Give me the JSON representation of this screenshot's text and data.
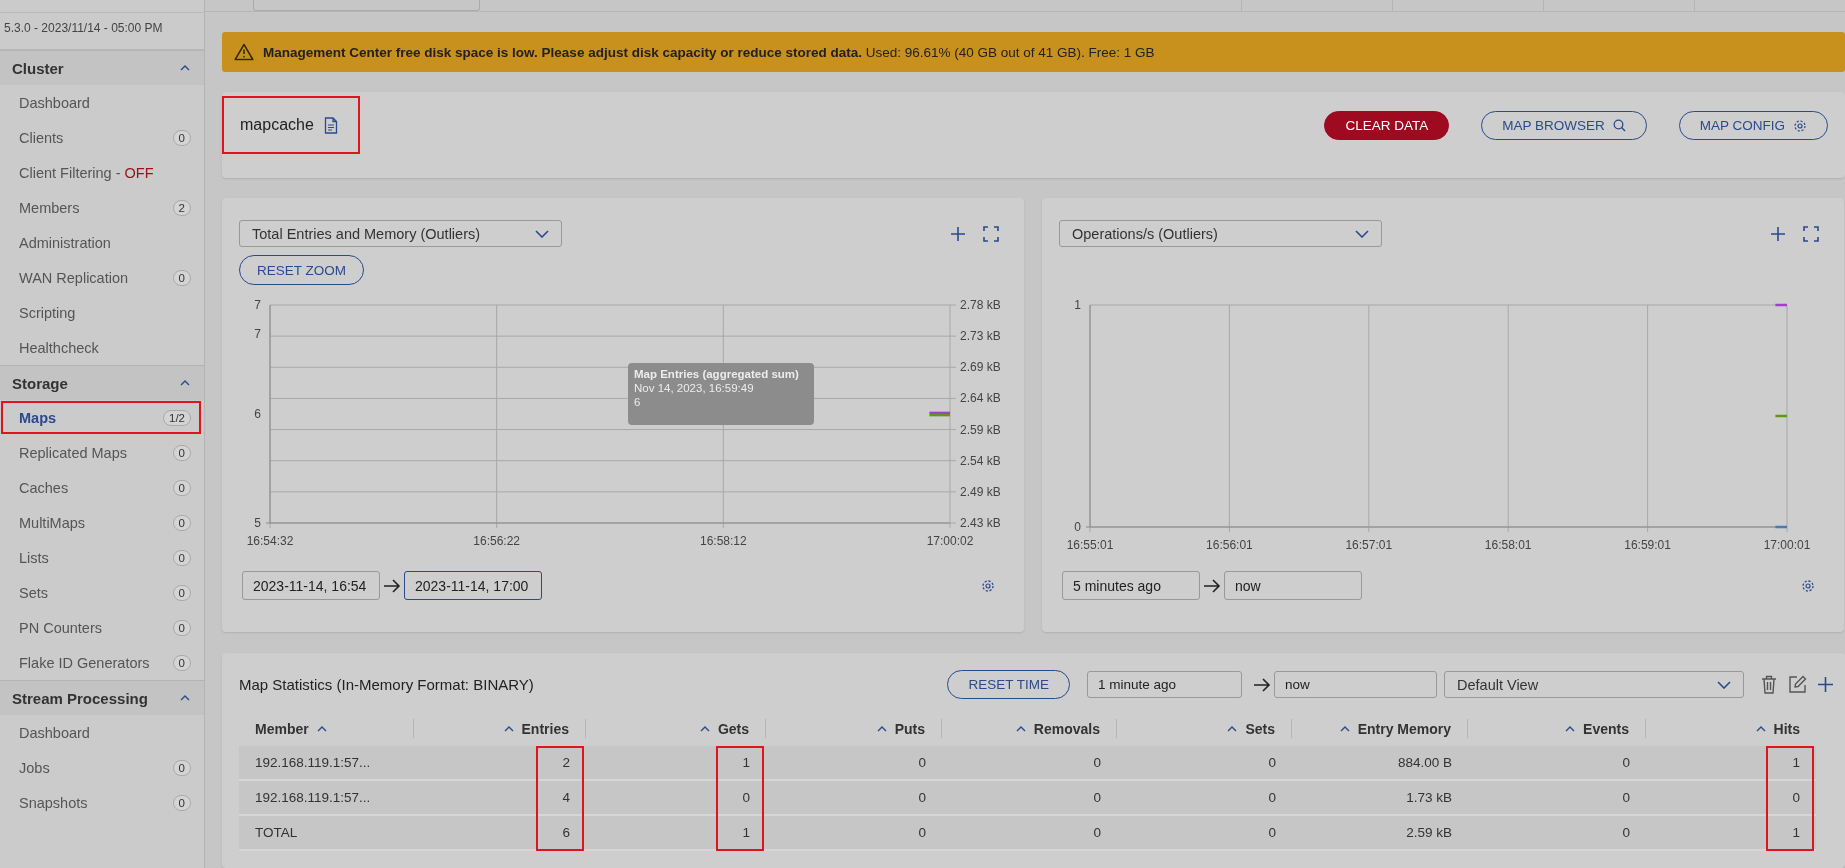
{
  "sidebar": {
    "version": "5.3.0 - 2023/11/14 - 05:00 PM",
    "sections": [
      {
        "title": "Cluster",
        "expanded": true,
        "items": [
          {
            "label": "Dashboard",
            "selected": false,
            "highlighted": false
          },
          {
            "label": "Clients",
            "badge": "0",
            "selected": false,
            "highlighted": false
          },
          {
            "label": "Client Filtering -",
            "status": "OFF",
            "selected": false,
            "highlighted": false
          },
          {
            "label": "Members",
            "badge": "2",
            "selected": false,
            "highlighted": false
          },
          {
            "label": "Administration",
            "selected": false,
            "highlighted": false
          },
          {
            "label": "WAN Replication",
            "badge": "0",
            "selected": false,
            "highlighted": false
          },
          {
            "label": "Scripting",
            "selected": false,
            "highlighted": false
          },
          {
            "label": "Healthcheck",
            "selected": false,
            "highlighted": false
          }
        ]
      },
      {
        "title": "Storage",
        "expanded": true,
        "items": [
          {
            "label": "Maps",
            "badge": "1/2",
            "selected": true,
            "highlighted": true
          },
          {
            "label": "Replicated Maps",
            "badge": "0",
            "selected": false,
            "highlighted": false
          },
          {
            "label": "Caches",
            "badge": "0",
            "selected": false,
            "highlighted": false
          },
          {
            "label": "MultiMaps",
            "badge": "0",
            "selected": false,
            "highlighted": false
          },
          {
            "label": "Lists",
            "badge": "0",
            "selected": false,
            "highlighted": false
          },
          {
            "label": "Sets",
            "badge": "0",
            "selected": false,
            "highlighted": false
          },
          {
            "label": "PN Counters",
            "badge": "0",
            "selected": false,
            "highlighted": false
          },
          {
            "label": "Flake ID Generators",
            "badge": "0",
            "selected": false,
            "highlighted": false
          }
        ]
      },
      {
        "title": "Stream Processing",
        "expanded": true,
        "items": [
          {
            "label": "Dashboard",
            "selected": false,
            "highlighted": false
          },
          {
            "label": "Jobs",
            "badge": "0",
            "selected": false,
            "highlighted": false
          },
          {
            "label": "Snapshots",
            "badge": "0",
            "selected": false,
            "highlighted": false
          }
        ]
      }
    ]
  },
  "banner": {
    "message": "**Management Center free disk space is low. Please adjust disk capacity or reduce stored data.** Used: 96.61% (40 GB out of 41 GB). Free: 1 GB"
  },
  "header": {
    "title": "mapcache",
    "highlighted": true,
    "buttons": [
      {
        "label": "CLEAR DATA",
        "kind": "danger"
      },
      {
        "label": "MAP BROWSER",
        "kind": "search"
      },
      {
        "label": "MAP CONFIG",
        "kind": "config"
      }
    ]
  },
  "charts": [
    {
      "metric": "Total Entries and Memory (Outliers)",
      "reset_zoom": "RESET ZOOM",
      "range_from": "2023-11-14, 16:54",
      "range_to": "2023-11-14, 17:00",
      "range_to_focused": true,
      "tooltip": {
        "title": "Map Entries (aggregated sum)",
        "time": "Nov 14, 2023, 16:59:49",
        "value": "6"
      },
      "chart_data": {
        "type": "line",
        "grid": true,
        "ylim": [
          5,
          7
        ],
        "categories": [
          "16:54:32",
          null,
          null,
          null,
          null,
          null,
          null,
          null,
          null,
          null,
          null,
          "16:56:22",
          null,
          null,
          null,
          null,
          null,
          null,
          null,
          null,
          null,
          null,
          "16:58:12",
          null,
          null,
          null,
          null,
          null,
          null,
          null,
          null,
          null,
          null,
          "17:00:02"
        ],
        "yticks": [
          {
            "value": 7,
            "label": "7"
          },
          {
            "value": 6.73,
            "label": "7"
          },
          {
            "value": 6,
            "label": "6"
          },
          {
            "value": 5,
            "label": "5"
          }
        ],
        "y2ticks": [
          "2.78 kB",
          "2.73 kB",
          "2.69 kB",
          "2.64 kB",
          "2.59 kB",
          "2.54 kB",
          "2.49 kB",
          "2.43 kB"
        ],
        "series": [
          {
            "color": "#a040c8",
            "values": [
              null,
              null,
              null,
              null,
              null,
              null,
              null,
              null,
              null,
              null,
              null,
              null,
              null,
              null,
              null,
              null,
              null,
              null,
              null,
              null,
              null,
              null,
              null,
              null,
              null,
              null,
              null,
              null,
              null,
              null,
              null,
              null,
              6.01,
              6.01
            ]
          },
          {
            "color": "#5a9a10",
            "values": [
              null,
              null,
              null,
              null,
              null,
              null,
              null,
              null,
              null,
              null,
              null,
              null,
              null,
              null,
              null,
              null,
              null,
              null,
              null,
              null,
              null,
              null,
              null,
              null,
              null,
              null,
              null,
              null,
              null,
              null,
              null,
              null,
              5.99,
              5.99
            ]
          }
        ]
      }
    },
    {
      "metric": "Operations/s (Outliers)",
      "range_from": "5 minutes ago",
      "range_to": "now",
      "range_to_focused": false,
      "chart_data": {
        "type": "line",
        "grid": true,
        "ylim": [
          0,
          1
        ],
        "categories": [
          "16:55:01",
          null,
          null,
          null,
          null,
          null,
          null,
          null,
          null,
          null,
          null,
          null,
          "16:56:01",
          null,
          null,
          null,
          null,
          null,
          null,
          null,
          null,
          null,
          null,
          null,
          "16:57:01",
          null,
          null,
          null,
          null,
          null,
          null,
          null,
          null,
          null,
          null,
          null,
          "16:58:01",
          null,
          null,
          null,
          null,
          null,
          null,
          null,
          null,
          null,
          null,
          null,
          "16:59:01",
          null,
          null,
          null,
          null,
          null,
          null,
          null,
          null,
          null,
          null,
          null,
          "17:00:01"
        ],
        "yticks": [
          0,
          1
        ],
        "series": [
          {
            "color": "#a040c8",
            "values": [
              null,
              null,
              null,
              null,
              null,
              null,
              null,
              null,
              null,
              null,
              null,
              null,
              null,
              null,
              null,
              null,
              null,
              null,
              null,
              null,
              null,
              null,
              null,
              null,
              null,
              null,
              null,
              null,
              null,
              null,
              null,
              null,
              null,
              null,
              null,
              null,
              null,
              null,
              null,
              null,
              null,
              null,
              null,
              null,
              null,
              null,
              null,
              null,
              null,
              null,
              null,
              null,
              null,
              null,
              null,
              null,
              null,
              null,
              null,
              1,
              1
            ]
          },
          {
            "color": "#5a9a10",
            "values": [
              null,
              null,
              null,
              null,
              null,
              null,
              null,
              null,
              null,
              null,
              null,
              null,
              null,
              null,
              null,
              null,
              null,
              null,
              null,
              null,
              null,
              null,
              null,
              null,
              null,
              null,
              null,
              null,
              null,
              null,
              null,
              null,
              null,
              null,
              null,
              null,
              null,
              null,
              null,
              null,
              null,
              null,
              null,
              null,
              null,
              null,
              null,
              null,
              null,
              null,
              null,
              null,
              null,
              null,
              null,
              null,
              null,
              null,
              null,
              0.5,
              0.5
            ]
          },
          {
            "color": "#4a7ab0",
            "values": [
              null,
              null,
              null,
              null,
              null,
              null,
              null,
              null,
              null,
              null,
              null,
              null,
              null,
              null,
              null,
              null,
              null,
              null,
              null,
              null,
              null,
              null,
              null,
              null,
              null,
              null,
              null,
              null,
              null,
              null,
              null,
              null,
              null,
              null,
              null,
              null,
              null,
              null,
              null,
              null,
              null,
              null,
              null,
              null,
              null,
              null,
              null,
              null,
              null,
              null,
              null,
              null,
              null,
              null,
              null,
              null,
              null,
              null,
              null,
              0,
              0
            ]
          }
        ]
      }
    }
  ],
  "stats": {
    "title": "Map Statistics (In-Memory Format: BINARY)",
    "reset_time": "RESET TIME",
    "range_from": "1 minute ago",
    "range_to": "now",
    "view": "Default View",
    "columns": [
      {
        "label": "Member",
        "highlighted": false
      },
      {
        "label": "Entries",
        "highlighted": true
      },
      {
        "label": "Gets",
        "highlighted": true
      },
      {
        "label": "Puts",
        "highlighted": false
      },
      {
        "label": "Removals",
        "highlighted": false
      },
      {
        "label": "Sets",
        "highlighted": false
      },
      {
        "label": "Entry Memory",
        "highlighted": false
      },
      {
        "label": "Events",
        "highlighted": false
      },
      {
        "label": "Hits",
        "highlighted": true
      }
    ],
    "rows": [
      [
        "192.168.119.1:57...",
        "2",
        "1",
        "0",
        "0",
        "0",
        "884.00 B",
        "0",
        "1"
      ],
      [
        "192.168.119.1:57...",
        "4",
        "0",
        "0",
        "0",
        "0",
        "1.73 kB",
        "0",
        "0"
      ],
      [
        "TOTAL",
        "6",
        "1",
        "0",
        "0",
        "0",
        "2.59 kB",
        "0",
        "1"
      ]
    ]
  }
}
